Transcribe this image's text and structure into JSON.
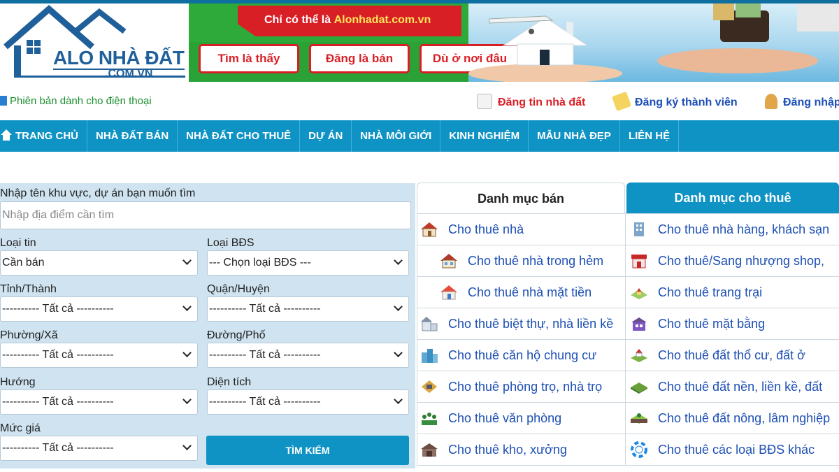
{
  "logo": {
    "name": "ALO NHÀ ĐẤT",
    "domain": ".COM.VN"
  },
  "ad": {
    "slogan_prefix": "Chỉ có thể là ",
    "slogan_site": "Alonhadat.com.vn",
    "buttons": [
      "Tìm là thấy",
      "Đăng là bán",
      "Dù ở nơi đâu"
    ]
  },
  "subheader": {
    "mobile": "Phiên bản dành cho điện thoại",
    "post": "Đăng tin nhà đất",
    "register": "Đăng ký thành viên",
    "login": "Đăng nhập"
  },
  "nav": [
    "TRANG CHỦ",
    "NHÀ ĐẤT BÁN",
    "NHÀ ĐẤT CHO THUÊ",
    "DỰ ÁN",
    "NHÀ MÔI GIỚI",
    "KINH NGHIỆM",
    "MẪU NHÀ ĐẸP",
    "LIÊN HỆ"
  ],
  "search": {
    "keyword_label": "Nhập tên khu vực, dự án bạn muốn tìm",
    "keyword_placeholder": "Nhập địa điểm cần tìm",
    "fields": {
      "loai_tin": {
        "label": "Loại tin",
        "value": "Cần bán"
      },
      "loai_bds": {
        "label": "Loại BĐS",
        "value": "--- Chọn loại BĐS ---"
      },
      "tinh": {
        "label": "Tỉnh/Thành",
        "value": "---------- Tất cả ----------"
      },
      "quan": {
        "label": "Quận/Huyện",
        "value": "---------- Tất cả ----------"
      },
      "phuong": {
        "label": "Phường/Xã",
        "value": "---------- Tất cả ----------"
      },
      "duong": {
        "label": "Đường/Phố",
        "value": "---------- Tất cả ----------"
      },
      "huong": {
        "label": "Hướng",
        "value": "---------- Tất cả ----------"
      },
      "dien_tich": {
        "label": "Diện tích",
        "value": "---------- Tất cả ----------"
      },
      "muc_gia": {
        "label": "Mức giá",
        "value": "---------- Tất cả ----------"
      }
    },
    "button": "TÌM KIẾM"
  },
  "categories": {
    "tab_sale": "Danh mục bán",
    "tab_rent": "Danh mục cho thuê",
    "left": [
      "Cho thuê nhà",
      "Cho thuê nhà trong hẻm",
      "Cho thuê nhà mặt tiền",
      "Cho thuê biệt thự, nhà liền kề",
      "Cho thuê căn hộ chung cư",
      "Cho thuê phòng trọ, nhà trọ",
      "Cho thuê văn phòng",
      "Cho thuê kho, xưởng"
    ],
    "right": [
      "Cho thuê nhà hàng, khách sạn",
      "Cho thuê/Sang nhượng shop,",
      "Cho thuê trang trại",
      "Cho thuê mặt bằng",
      "Cho thuê đất thổ cư, đất ở",
      "Cho thuê đất nền, liền kề, đất",
      "Cho thuê đất nông, lâm nghiệp",
      "Cho thuê các loại BĐS khác"
    ]
  },
  "colors": {
    "accent": "#0f93c4",
    "link": "#1d4fb5",
    "danger": "#d91f26",
    "green": "#1a8f2c"
  }
}
